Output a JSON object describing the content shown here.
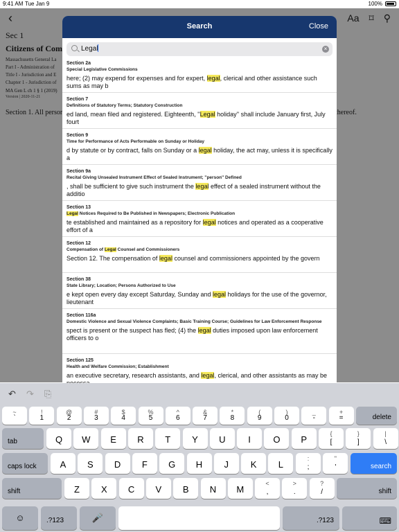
{
  "status": {
    "time": "9:41 AM",
    "date": "Tue Jan 9",
    "battery": "100%"
  },
  "nav": {
    "back": "‹",
    "font_size": "Aa",
    "bookmark": "⌑",
    "search": "⚲"
  },
  "doc": {
    "sec": "Sec 1",
    "title": "Citizens of Comm",
    "crumbs": [
      "Massachusetts General La",
      "Part I - Administration of",
      "Title I - Jurisdiction and E",
      "Chapter 1 - Jurisdiction of"
    ],
    "cite": "MA Gen L ch 1 § 1 (2019)",
    "version": "Version | 2020-11-21",
    "body": "Section 1. All persor",
    "thereof": "thereof."
  },
  "modal": {
    "title": "Search",
    "close": "Close",
    "query": "Legal"
  },
  "results": [
    {
      "section": "Section 2a",
      "heading": "Special Legislative Commissions",
      "pre": "here; (2) may expend for expenses and for expert, ",
      "hl": "legal",
      "post": ", clerical and other assistance such sums as may b"
    },
    {
      "section": "Section 7",
      "heading": "Definitions of Statutory Terms; Statutory Construction",
      "pre": "ed land, mean filed and registered. Eighteenth, ''",
      "hl": "Legal",
      "post": " holiday'' shall include January first, July fourt"
    },
    {
      "section": "Section 9",
      "heading": "Time for Performance of Acts Performable on Sunday or Holiday",
      "pre": "d by statute or by contract, falls on Sunday or a ",
      "hl": "legal",
      "post": " holiday, the act may, unless it is specifically a"
    },
    {
      "section": "Section 9a",
      "heading": "Recital Giving Unsealed Instrument Effect of Sealed Instrument; ''person'' Defined",
      "pre": ", shall be sufficient to give such instrument the ",
      "hl": "legal",
      "post": " effect of a sealed instrument without the additio"
    },
    {
      "section": "Section 13",
      "heading_hl": "Legal",
      "heading": " Notices Required to Be Published in Newspapers; Electronic Publication",
      "pre": "te established and maintained as a repository for ",
      "hl": "legal",
      "post": " notices and operated as a cooperative effort of a"
    },
    {
      "section": "Section 12",
      "heading_pre": "Compensation of ",
      "heading_hl": "Legal",
      "heading": " Counsel and Commissioners",
      "pre": "Section 12. The compensation of ",
      "hl": "legal",
      "post": " counsel and commissioners appointed by the govern"
    },
    {
      "section": "Section 38",
      "heading": "State Library; Location; Persons Authorized to Use",
      "pre": "e kept open every day except Saturday, Sunday and ",
      "hl": "legal",
      "post": " holidays for the use of the governor, lieutenant"
    },
    {
      "section": "Section 116a",
      "heading": "Domestic Violence and Sexual Violence Complaints; Basic Training Course; Guidelines for Law Enforcement Response",
      "pre": "spect is present or the suspect has fled; (4) the ",
      "hl": "legal",
      "post": " duties imposed upon law enforcement officers to o"
    },
    {
      "section": "Section 125",
      "heading": "Health and Welfare Commission; Establishment",
      "pre": " an executive secretary, research assistants, and ",
      "hl": "legal",
      "post": ", clerical, and other assistants as may be necessa"
    }
  ],
  "keyboard": {
    "toolbar": {
      "undo": "↶",
      "redo": "↷",
      "paste": "⎘"
    },
    "row1": [
      [
        "~",
        "`"
      ],
      [
        "!",
        "1"
      ],
      [
        "@",
        "2"
      ],
      [
        "#",
        "3"
      ],
      [
        "$",
        "4"
      ],
      [
        "%",
        "5"
      ],
      [
        "^",
        "6"
      ],
      [
        "&",
        "7"
      ],
      [
        "*",
        "8"
      ],
      [
        "(",
        "9"
      ],
      [
        ")",
        "0"
      ],
      [
        "_",
        "-"
      ],
      [
        "+",
        "="
      ]
    ],
    "delete": "delete",
    "tab": "tab",
    "row2": [
      "Q",
      "W",
      "E",
      "R",
      "T",
      "Y",
      "U",
      "I",
      "O",
      "P"
    ],
    "row2b": [
      [
        "{",
        "["
      ],
      [
        "}",
        "]"
      ],
      [
        "|",
        "\\"
      ]
    ],
    "caps": "caps lock",
    "row3": [
      "A",
      "S",
      "D",
      "F",
      "G",
      "H",
      "J",
      "K",
      "L"
    ],
    "row3b": [
      [
        ":",
        ";"
      ],
      [
        "\"",
        "'"
      ]
    ],
    "search": "search",
    "shift": "shift",
    "row4": [
      "Z",
      "X",
      "C",
      "V",
      "B",
      "N",
      "M"
    ],
    "row4b": [
      [
        "<",
        ","
      ],
      [
        ">",
        "."
      ],
      [
        "?",
        "/"
      ]
    ],
    "emoji": "☺",
    "num": ".?123",
    "mic": "🎤",
    "hide": "⌨"
  }
}
